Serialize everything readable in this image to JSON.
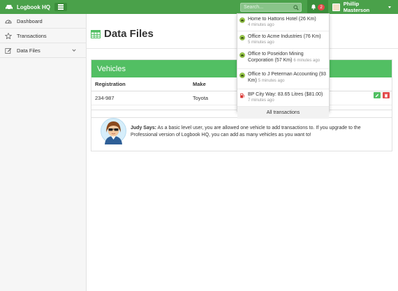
{
  "app": {
    "brand": "Logbook HQ"
  },
  "topbar": {
    "search_placeholder": "Search...",
    "notification_count": "2",
    "user_name": "Phillip Masterson"
  },
  "sidebar": {
    "items": [
      {
        "label": "Dashboard",
        "icon": "dashboard-icon"
      },
      {
        "label": "Transactions",
        "icon": "star-icon"
      },
      {
        "label": "Data Files",
        "icon": "edit-icon"
      }
    ]
  },
  "main": {
    "page_title": "Data Files",
    "panel_title": "Vehicles",
    "columns": [
      "Registration",
      "Make"
    ],
    "rows": [
      {
        "registration": "234-987",
        "make": "Toyota"
      }
    ],
    "judy": {
      "name": "Judy Says:",
      "message": "As a basic level user, you are allowed one vehicle to add transactions to. If you upgrade to the Professional version of Logbook HQ, you can add as many vehicles as you want to!"
    }
  },
  "dropdown": {
    "items": [
      {
        "title": "Home to Hattons Hotel (26 Km)",
        "time": "4 minutes ago",
        "type": "trip"
      },
      {
        "title": "Office to Acme Industries (76 Km)",
        "time": "5 minutes ago",
        "type": "trip"
      },
      {
        "title": "Office to Poseidon Mining Corporation (57 Km)",
        "time": "6 minutes ago",
        "type": "trip"
      },
      {
        "title": "Office to J Peterman Accounting (93 Km)",
        "time": "5 minutes ago",
        "type": "trip"
      },
      {
        "title": "BP City Way: 83.65 Litres ($81.00)",
        "time": "7 minutes ago",
        "type": "fuel"
      }
    ],
    "all_label": "All transactions"
  },
  "colors": {
    "topbar": "#4aa14a",
    "panel_head": "#52bf63",
    "badge": "#e24a4a",
    "edit": "#52bf63",
    "delete": "#e24a4a"
  }
}
